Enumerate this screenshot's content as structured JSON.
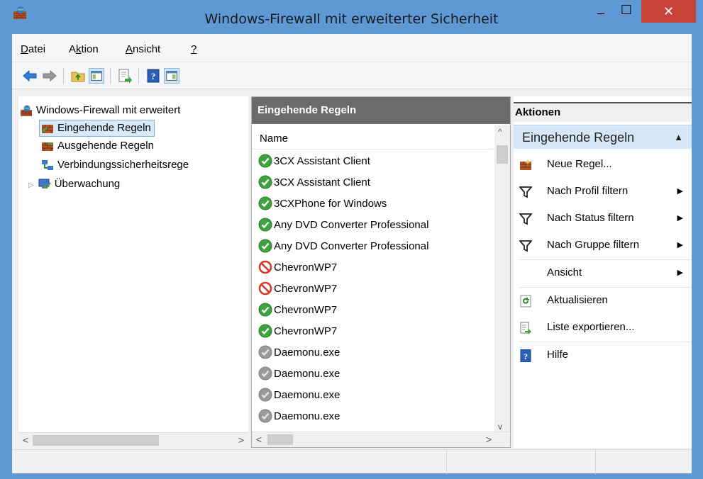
{
  "window": {
    "title": "Windows-Firewall mit erweiterter Sicherheit",
    "minimize": "–",
    "maximize": "☐",
    "close": "✕"
  },
  "menu": [
    {
      "label": "Datei",
      "accel": "D"
    },
    {
      "label": "Aktion",
      "accel": "k"
    },
    {
      "label": "Ansicht",
      "accel": "A"
    },
    {
      "label": "?",
      "accel": "?"
    }
  ],
  "toolbar": {
    "icons": [
      "back-arrow-icon",
      "forward-arrow-icon",
      "up-folder-icon",
      "show-hide-tree-icon",
      "export-list-icon",
      "help-icon",
      "show-hide-action-pane-icon"
    ]
  },
  "tree": {
    "root": "Windows-Firewall mit erweitert",
    "items": [
      {
        "label": "Eingehende Regeln",
        "selected": true
      },
      {
        "label": "Ausgehende Regeln",
        "selected": false
      },
      {
        "label": "Verbindungssicherheitsrege",
        "selected": false
      },
      {
        "label": "Überwachung",
        "selected": false,
        "expandable": true
      }
    ],
    "scroll_left": "<",
    "scroll_right": ">"
  },
  "rules": {
    "header": "Eingehende Regeln",
    "column_name": "Name",
    "rows": [
      {
        "name": "3CX Assistant Client",
        "status": "allow"
      },
      {
        "name": "3CX Assistant Client",
        "status": "allow"
      },
      {
        "name": "3CXPhone for Windows",
        "status": "allow"
      },
      {
        "name": "Any DVD Converter Professional",
        "status": "allow"
      },
      {
        "name": "Any DVD Converter Professional",
        "status": "allow"
      },
      {
        "name": "ChevronWP7",
        "status": "block"
      },
      {
        "name": "ChevronWP7",
        "status": "block"
      },
      {
        "name": "ChevronWP7",
        "status": "allow"
      },
      {
        "name": "ChevronWP7",
        "status": "allow"
      },
      {
        "name": "Daemonu.exe",
        "status": "disabled"
      },
      {
        "name": "Daemonu.exe",
        "status": "disabled"
      },
      {
        "name": "Daemonu.exe",
        "status": "disabled"
      },
      {
        "name": "Daemonu.exe",
        "status": "disabled"
      }
    ],
    "scroll_up": "^",
    "scroll_down": "v",
    "scroll_left": "<",
    "scroll_right": ">"
  },
  "actions": {
    "header": "Aktionen",
    "group": "Eingehende Regeln",
    "items": [
      {
        "label": "Neue Regel...",
        "icon": "new-rule-icon",
        "submenu": false
      },
      {
        "label": "Nach Profil filtern",
        "icon": "filter-icon",
        "submenu": true
      },
      {
        "label": "Nach Status filtern",
        "icon": "filter-icon",
        "submenu": true
      },
      {
        "label": "Nach Gruppe filtern",
        "icon": "filter-icon",
        "submenu": true
      },
      {
        "label": "Ansicht",
        "icon": "",
        "submenu": true
      },
      {
        "label": "Aktualisieren",
        "icon": "refresh-icon",
        "submenu": false
      },
      {
        "label": "Liste exportieren...",
        "icon": "export-list-icon",
        "submenu": false
      },
      {
        "label": "Hilfe",
        "icon": "help-icon",
        "submenu": false
      }
    ]
  },
  "colors": {
    "titlebar": "#5e99d6",
    "close_button": "#c7433a",
    "allow": "#3ea33e",
    "block": "#d13b2f",
    "disabled": "#9a9a9a",
    "selection": "#d8e9f8"
  }
}
